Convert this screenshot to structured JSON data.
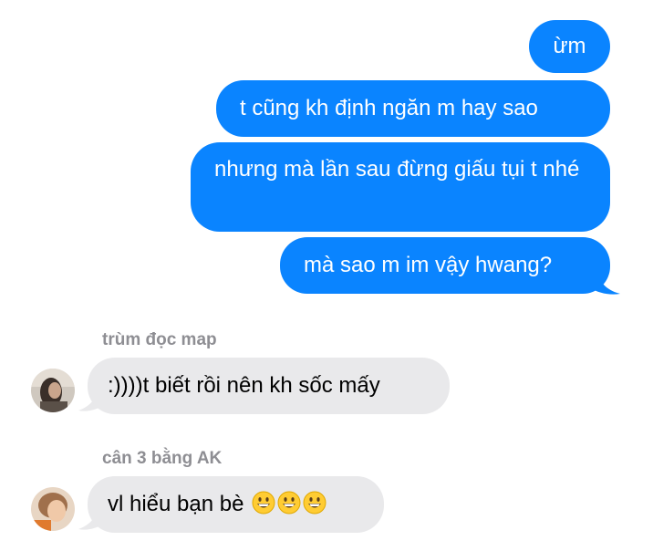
{
  "outgoing": [
    {
      "text": "ừm"
    },
    {
      "text": "t cũng kh định ngăn m hay sao"
    },
    {
      "text": "nhưng mà lần sau đừng giấu tụi t nhé"
    },
    {
      "text": "mà sao m im vậy hwang?"
    }
  ],
  "incoming": [
    {
      "sender": "trùm đọc map",
      "text": ":))))t biết rồi nên kh sốc mấy"
    },
    {
      "sender": "cân 3 bằng AK",
      "text": "vl hiểu bạn bè",
      "emojis": [
        "grinning-face-emoji",
        "grinning-face-emoji",
        "grinning-face-emoji"
      ]
    }
  ],
  "colors": {
    "outgoing_bubble": "#0a84ff",
    "incoming_bubble": "#e9e9eb",
    "sender_name": "#8e8e93"
  }
}
